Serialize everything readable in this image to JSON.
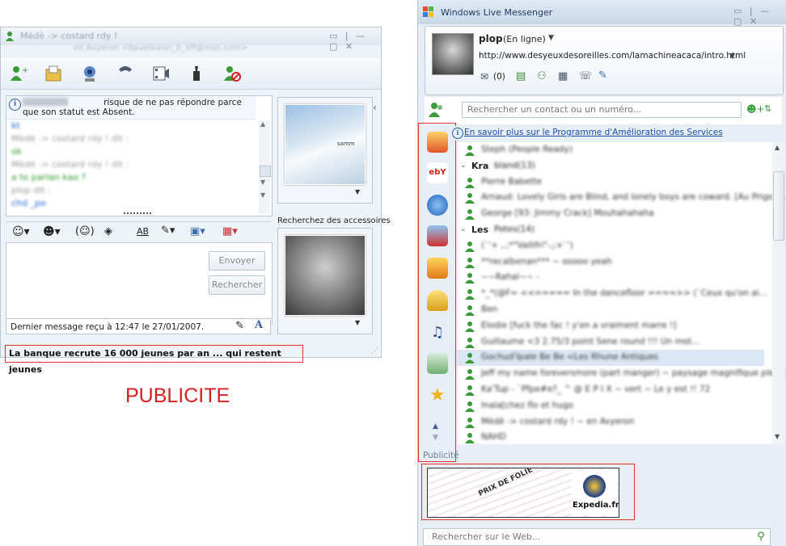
{
  "conversation": {
    "title_blurred": "Mèdè -> costard rdy !",
    "subtitle_blurred": "en Avyeron <bavelealsn_b_off@msn.com>",
    "info_note": "risque de ne pas répondre parce que son statut est Absent.",
    "history": [
      {
        "text": "kt",
        "color": "#1a5fd0"
      },
      {
        "text": "Mèdè -> costard rdy ! dit :",
        "color": "#999999"
      },
      {
        "text": "ok",
        "color": "#2a9a2a"
      },
      {
        "text": "Mèdè -> costard rdy ! dit :",
        "color": "#999999"
      },
      {
        "text": "a to parlan kao ?",
        "color": "#2a9a2a"
      },
      {
        "text": "plop dit :",
        "color": "#999999"
      },
      {
        "text": "chd _po",
        "color": "#1a5fd0"
      }
    ],
    "send_label": "Envoyer",
    "search_label": "Rechercher",
    "last_message": "Dernier message reçu à 12:47 le 27/01/2007.",
    "accessories_label": "Recherchez des accessoires",
    "ad_text": "La banque recrute 16 000 jeunes par an ... qui restent jeunes",
    "landscape_caption": "samm"
  },
  "publicite_label": "PUBLICITE",
  "messenger": {
    "app_title": "Windows Live Messenger",
    "user_name": "plop",
    "user_status": "(En ligne)",
    "user_url": "http://www.desyeuxdesoreilles.com/lamachineacaca/intro.html",
    "mail_count": "(0)",
    "search_placeholder": "Rechercher un contact ou un numéro...",
    "info_link": "En savoir plus sur le Programme d'Amélioration des Services",
    "groups": [
      {
        "label": "Kra",
        "count": "bland(13)"
      },
      {
        "label": "Les",
        "count": "Potes(14)"
      }
    ],
    "contacts": [
      "Steph (People Ready)",
      "Kra bland(13)",
      "Pierre Babette",
      "Arnaud: Lovely Girls are Blind, and lonely boys are coward. [Au Prigo L...",
      "George [93: Jimmy Crack] Mouhahahaha",
      "Les Potes(14)",
      "(`'+ ,.;*\"Vallifri\"-,;+`')",
      "**recalbenan*** ~ ooooo yeah",
      "~~Rahal~~ -",
      "*_*(@F= <<===== In the dancefloor ====>> (`Ceux qu'on ai...",
      "Ben",
      "Elodie [fuck the fac ! y'en a vraiment marre !]",
      "Guillaume <3    2.75/3 point    Sene round !!!    Un mot...",
      "Gochud'Ipale  Be Be  <Les Rhune Antiques",
      "Jeff my name foreversmore (part manger) ~ paysage magnifique plei...",
      "Ka'Tup - `Pfpe#e?_ ^ @ E P I X ~ vert ~ Le y est !! 72",
      "Inala[chez flo et hugo",
      "Mèdè -> costard rdy ! ~ en Avyeron",
      "NAHD"
    ],
    "publicite_label": "Publicité",
    "web_search_placeholder": "Rechercher sur le Web...",
    "ad_brand": "Expedia.fr",
    "ad_slogan": "PRIX DE FOLIE"
  }
}
